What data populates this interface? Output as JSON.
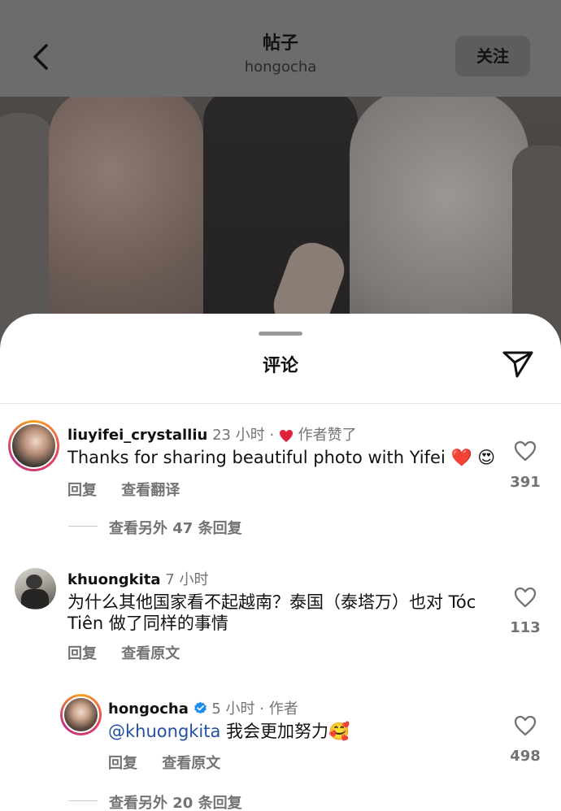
{
  "header": {
    "title": "帖子",
    "username": "hongocha",
    "follow_label": "关注"
  },
  "sheet": {
    "title": "评论"
  },
  "comments": [
    {
      "username": "liuyifei_crystalliu",
      "time": "23 小时",
      "separator": "·",
      "liked_by_author": "作者赞了",
      "text": "Thanks for sharing beautiful photo with Yifei ❤️ 😍",
      "reply_label": "回复",
      "translate_label": "查看翻译",
      "likes": "391",
      "more_replies": "查看另外 47 条回复"
    },
    {
      "username": "khuongkita",
      "time": "7 小时",
      "text_line1": "为什么其他国家看不起越南？泰国（泰塔万）也对 Tóc",
      "text_line2": "Tiên 做了同样的事情",
      "reply_label": "回复",
      "original_label": "查看原文",
      "likes": "113"
    },
    {
      "username": "hongocha",
      "time": "5 小时",
      "separator": "·",
      "author_label": "作者",
      "mention": "@khuongkita",
      "text": " 我会更加努力🥰",
      "reply_label": "回复",
      "original_label": "查看原文",
      "likes": "498",
      "more_replies": "查看另外 20 条回复"
    }
  ]
}
